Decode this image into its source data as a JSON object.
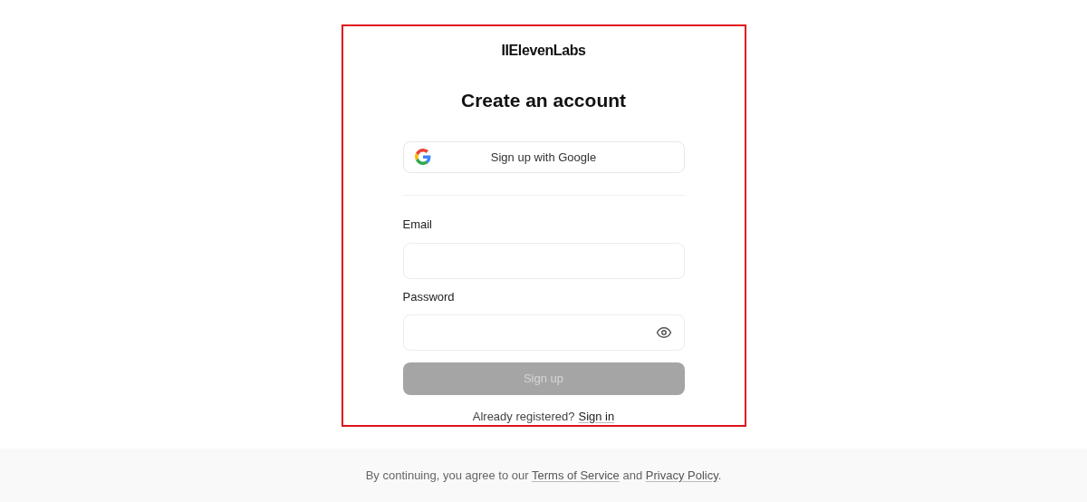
{
  "logo": "IIElevenLabs",
  "title": "Create an account",
  "google_button": {
    "label": "Sign up with Google"
  },
  "fields": [
    {
      "label": "Email",
      "kind": "email"
    },
    {
      "label": "Password",
      "kind": "password"
    }
  ],
  "submit": {
    "label": "Sign up",
    "disabled": true
  },
  "signin": {
    "prompt": "Already registered?",
    "link": "Sign in"
  },
  "footer": {
    "prefix": "By continuing, you agree to our",
    "terms": "Terms of Service",
    "middle": "and",
    "privacy": "Privacy Policy",
    "suffix": "."
  }
}
